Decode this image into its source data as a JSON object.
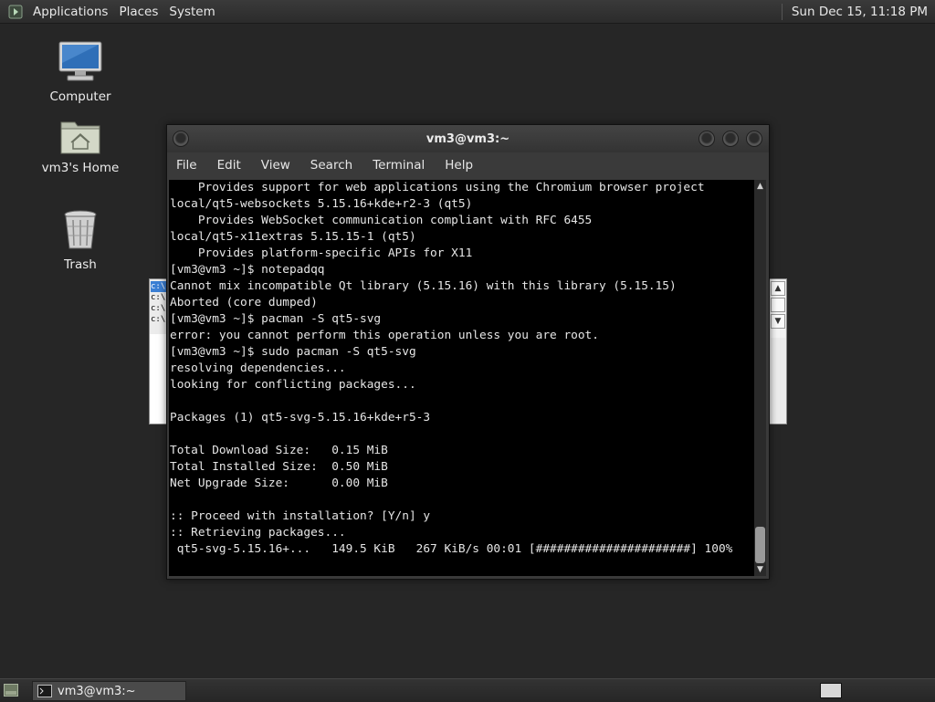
{
  "top_panel": {
    "menus": [
      "Applications",
      "Places",
      "System"
    ],
    "clock": "Sun Dec 15, 11:18 PM"
  },
  "desktop": {
    "icons": [
      {
        "label": "Computer",
        "icon": "monitor-icon"
      },
      {
        "label": "vm3's Home",
        "icon": "home-folder-icon"
      },
      {
        "label": "Trash",
        "icon": "trash-icon"
      }
    ]
  },
  "background_window": {
    "list_items": [
      "c:\\",
      "c:\\",
      "c:\\",
      "c:\\"
    ]
  },
  "terminal": {
    "title": "vm3@vm3:~",
    "menus": [
      "File",
      "Edit",
      "View",
      "Search",
      "Terminal",
      "Help"
    ],
    "lines": [
      "    Provides support for web applications using the Chromium browser project",
      "local/qt5-websockets 5.15.16+kde+r2-3 (qt5)",
      "    Provides WebSocket communication compliant with RFC 6455",
      "local/qt5-x11extras 5.15.15-1 (qt5)",
      "    Provides platform-specific APIs for X11",
      "[vm3@vm3 ~]$ notepadqq",
      "Cannot mix incompatible Qt library (5.15.16) with this library (5.15.15)",
      "Aborted (core dumped)",
      "[vm3@vm3 ~]$ pacman -S qt5-svg",
      "error: you cannot perform this operation unless you are root.",
      "[vm3@vm3 ~]$ sudo pacman -S qt5-svg",
      "resolving dependencies...",
      "looking for conflicting packages...",
      "",
      "Packages (1) qt5-svg-5.15.16+kde+r5-3",
      "",
      "Total Download Size:   0.15 MiB",
      "Total Installed Size:  0.50 MiB",
      "Net Upgrade Size:      0.00 MiB",
      "",
      ":: Proceed with installation? [Y/n] y",
      ":: Retrieving packages...",
      " qt5-svg-5.15.16+...   149.5 KiB   267 KiB/s 00:01 [######################] 100%"
    ]
  },
  "bottom_panel": {
    "task_label": "vm3@vm3:~"
  }
}
